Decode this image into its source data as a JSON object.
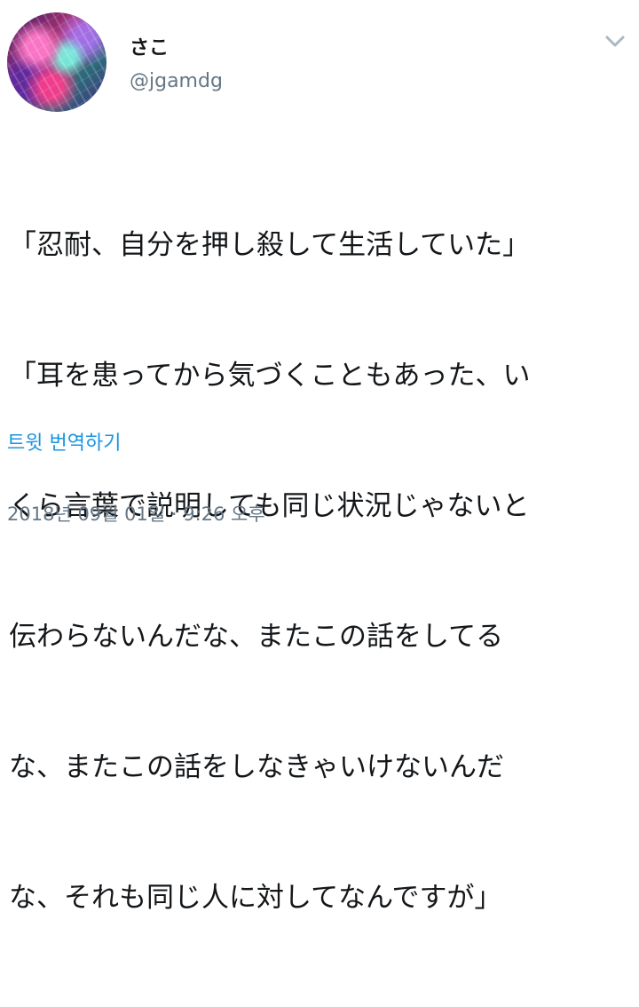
{
  "tweet": {
    "display_name": "さこ",
    "handle": "@jgamdg",
    "lines": [
      "「忍耐、自分を押し殺して生活していた」",
      "「耳を患ってから気づくこともあった、い",
      "くら言葉で説明しても同じ状況じゃないと",
      "伝わらないんだな、またこの話をしてる",
      "な、またこの話をしなきゃいけないんだ",
      "な、それも同じ人に対してなんですが」"
    ],
    "translate_label": "트윗 번역하기",
    "timestamp": "2018년 09월 01일 · 9:26 오후"
  },
  "icons": {
    "menu_caret": "chevron-down-icon",
    "avatar": "avatar"
  },
  "colors": {
    "text": "#14171a",
    "secondary": "#657786",
    "link": "#1b95e0",
    "background": "#ffffff"
  }
}
